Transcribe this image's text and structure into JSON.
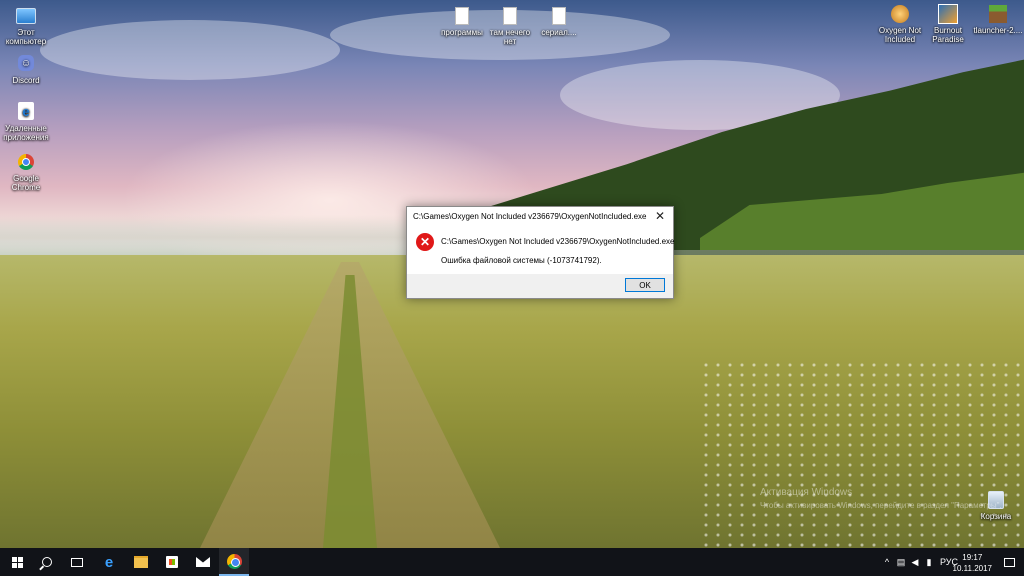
{
  "desktop": {
    "icons_left": [
      {
        "label": "Этот компьютер",
        "icon": "this-pc-icon"
      },
      {
        "label": "Discord",
        "icon": "discord-icon"
      },
      {
        "label": "Удаленные приложения",
        "icon": "edge-icon"
      },
      {
        "label": "Google Chrome",
        "icon": "chrome-icon"
      }
    ],
    "icons_top": [
      {
        "label": "программы",
        "icon": "file-icon"
      },
      {
        "label": "там нечего нет",
        "icon": "file-icon"
      },
      {
        "label": "сериал....",
        "icon": "file-icon"
      }
    ],
    "icons_right": [
      {
        "label": "Oxygen Not Included",
        "icon": "oxygen-not-included-icon"
      },
      {
        "label": "Burnout Paradise",
        "icon": "burnout-paradise-icon"
      },
      {
        "label": "tlauncher-2....",
        "icon": "minecraft-icon"
      }
    ],
    "recycle_bin": {
      "label": "Корзина",
      "icon": "recycle-bin-icon"
    }
  },
  "dialog": {
    "title": "C:\\Games\\Oxygen Not Included v236679\\OxygenNotIncluded.exe",
    "close_glyph": "✕",
    "error_glyph": "✕",
    "path": "C:\\Games\\Oxygen Not Included v236679\\OxygenNotIncluded.exe",
    "message": "Ошибка файловой системы (-1073741792).",
    "ok_label": "OK"
  },
  "watermark": {
    "line1": "Активация Windows",
    "line2": "Чтобы активировать Windows, перейдите в раздел \"Параметры\"."
  },
  "taskbar": {
    "pinned": [
      "start-icon",
      "search-icon",
      "task-view-icon",
      "edge-icon",
      "file-explorer-icon",
      "store-icon",
      "mail-icon",
      "chrome-icon"
    ],
    "active": "chrome-icon",
    "tray": {
      "chevron": "^",
      "language": "РУС",
      "time": "19:17",
      "date": "10.11.2017"
    }
  },
  "colors": {
    "taskbar": "#111318",
    "accent": "#0078d7",
    "error": "#e01818"
  }
}
